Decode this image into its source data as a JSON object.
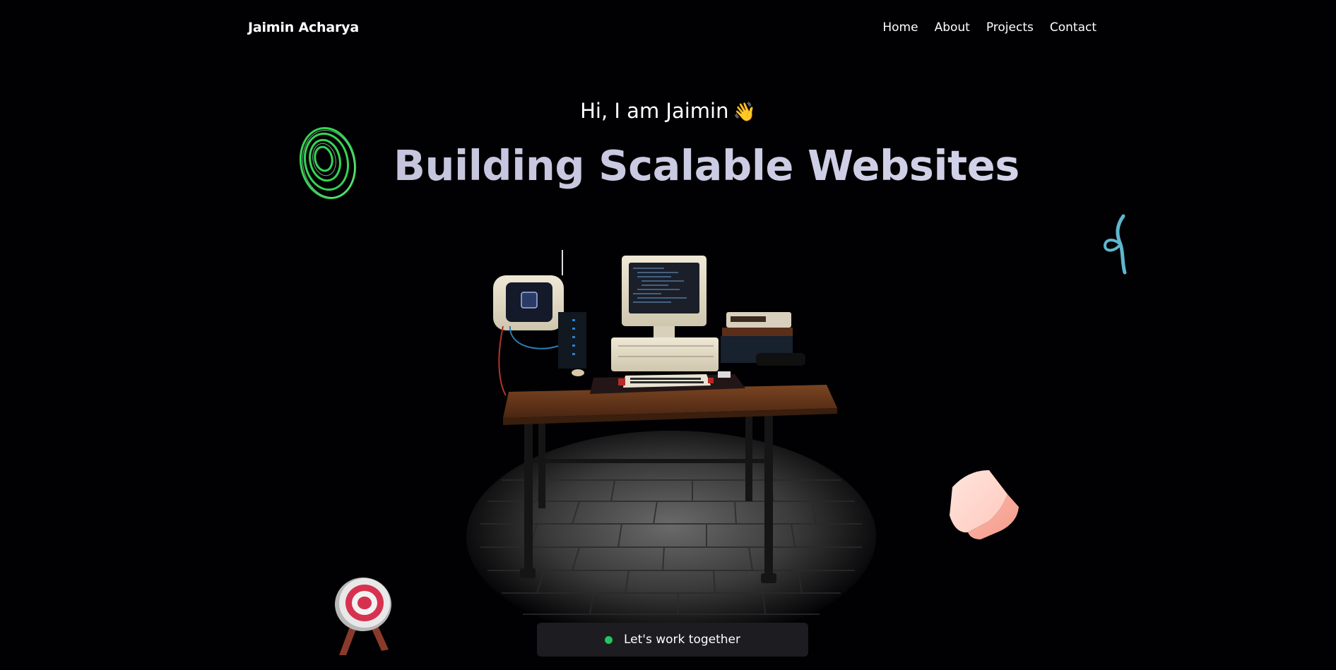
{
  "header": {
    "logo_text": "Jaimin Acharya",
    "nav": [
      {
        "label": "Home"
      },
      {
        "label": "About"
      },
      {
        "label": "Projects"
      },
      {
        "label": "Contact"
      }
    ]
  },
  "hero": {
    "greeting": "Hi, I am Jaimin",
    "wave_emoji": "👋",
    "headline": "Building Scalable Websites"
  },
  "cta": {
    "label": "Let's work together",
    "status_color": "#22c55e"
  },
  "decorations": {
    "icons": [
      "spiral-rings-icon",
      "ring-icon",
      "target-icon",
      "cube-icon",
      "desk-computer-scene"
    ]
  },
  "colors": {
    "background": "#010103",
    "headline": "#c7c7e0",
    "cta_background": "#1c1c21"
  }
}
